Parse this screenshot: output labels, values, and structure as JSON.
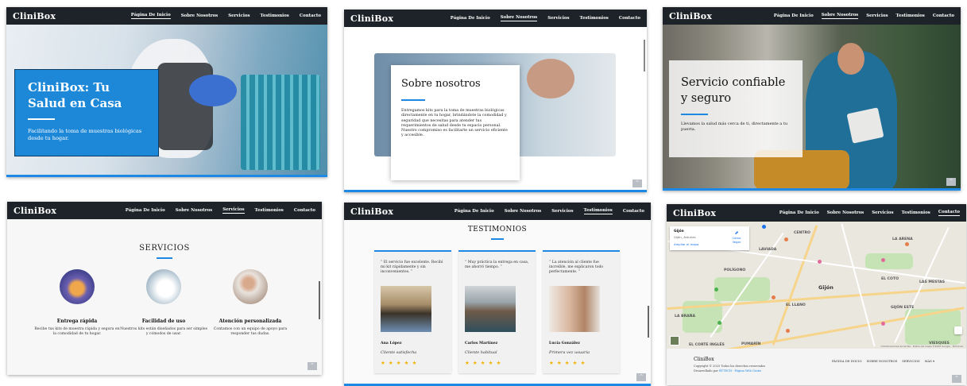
{
  "brand": "CliniBox",
  "nav": {
    "home": "Página De Inicio",
    "about": "Sobre Nosotros",
    "services": "Servicios",
    "testimonials": "Testimonios",
    "contact": "Contacto"
  },
  "scroll_top_glyph": "^",
  "hero": {
    "title": "CliniBox: Tu Salud en Casa",
    "subtitle": "Facilitando la toma de muestras biológicas desde tu hogar."
  },
  "about": {
    "title": "Sobre nosotros",
    "body": "Entregamos kits para la toma de muestras biológicas directamente en tu hogar, brindándote la comodidad y seguridad que necesitas para atender tus requerimientos de salud desde tu espacio personal. Nuestro compromiso es facilitarte un servicio eficiente y accesible."
  },
  "care": {
    "title": "Servicio confiable y seguro",
    "body": "Llevamos la salud más cerca de ti, directamente a tu puerta."
  },
  "services": {
    "title": "SERVICIOS",
    "items": [
      {
        "title": "Entrega rápida",
        "text": "Recibe tus kits de muestra rápida y segura en la comodidad de tu hogar."
      },
      {
        "title": "Facilidad de uso",
        "text": "Nuestros kits están diseñados para ser simples y cómodos de usar."
      },
      {
        "title": "Atención personalizada",
        "text": "Contamos con un equipo de apoyo para responder tus dudas."
      }
    ]
  },
  "testimonials": {
    "title": "TESTIMONIOS",
    "items": [
      {
        "quote": "“ El servicio fue excelente. Recibí mi kit rápidamente y sin inconvenientes. ”",
        "name": "Ana López",
        "role": "Cliente satisfecha",
        "stars": "★ ★ ★ ★ ★"
      },
      {
        "quote": "“ Muy práctica la entrega en casa, me ahorró tiempo. ”",
        "name": "Carlos Martínez",
        "role": "Cliente habitual",
        "stars": "★ ★ ★ ★ ★"
      },
      {
        "quote": "“ La atención al cliente fue increíble, me explicaron todo perfectamente. ”",
        "name": "Lucía González",
        "role": "Primera vez usuaria",
        "stars": "★ ★ ★ ★ ★"
      }
    ]
  },
  "map": {
    "place": "Gijón",
    "place_sub": "Gijón, Asturias",
    "enlarge": "Ampliar el mapa",
    "directions": "Cómo llegar",
    "city_label": "Gijón",
    "labels": [
      "CENTRO",
      "LA ARENA",
      "LAVIADA",
      "POLÍGONO",
      "EL COTO",
      "LAS MESTAS",
      "EL LLANO",
      "GIJÓN ESTE",
      "LA BRAÑA",
      "PUMARÍN",
      "VIESQUES",
      "EL CORTE INGLÉS"
    ],
    "attribution": "Combinaciones de teclas · Datos del mapa ©2025 Google · Términos"
  },
  "footer": {
    "brand": "CliniBox",
    "copyright": "Copyright © 2025 Todos los derechos reservados",
    "dev_prefix": "Desarrollado por",
    "dev_link": "BTTECH - Página Web Gratis",
    "links": [
      "PÁGINA DE INICIO",
      "SOBRE NOSOTROS",
      "SERVICIOS",
      "MÁS ▾"
    ]
  },
  "colors": {
    "navbar": "#1d2328",
    "accent": "#1e88e5",
    "stars": "#f0b400"
  }
}
